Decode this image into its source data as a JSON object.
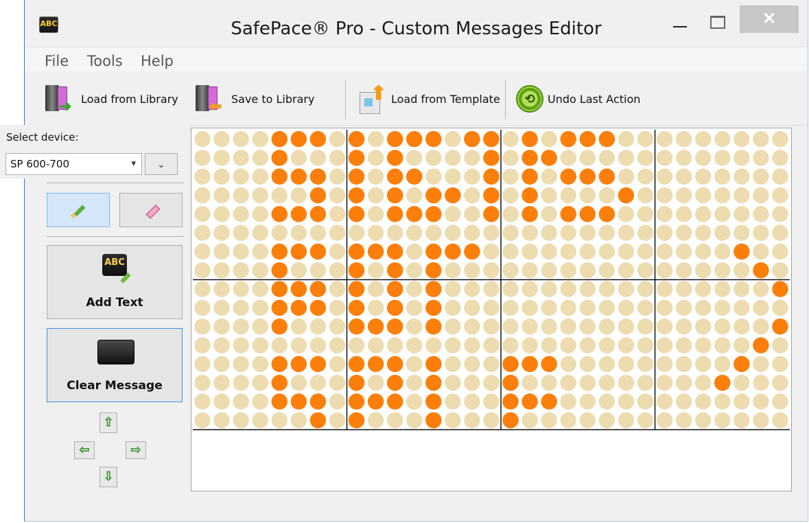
{
  "window": {
    "title": "SafePace® Pro - Custom Messages Editor",
    "app_icon_text": "ABC",
    "close_glyph": "✕"
  },
  "menu": {
    "items": [
      "File",
      "Tools",
      "Help"
    ]
  },
  "toolbar": {
    "load_library": "Load from Library",
    "save_library": "Save to Library",
    "load_template": "Load from Template",
    "undo": "Undo Last Action"
  },
  "device": {
    "label": "Select device:",
    "selected": "SP 600-700",
    "secondary_selected": ""
  },
  "side": {
    "add_text": "Add Text",
    "clear_message": "Clear Message",
    "arrows": {
      "up": "⇧",
      "left": "⇦",
      "right": "⇨",
      "down": "⇩"
    }
  },
  "led_display": {
    "columns": 31,
    "rows": 16,
    "on_color": "#fb7f0a",
    "off_color": "#ecdcb0",
    "pixels": [
      "0000111010111011010111000000000",
      "0000100010100001011000000000000",
      "0000111010110001010111000000000",
      "0000001010101101010000100000000",
      "0000111010111001010111000000000",
      "0000000000000000000000000000000",
      "0000111011101110000000000000100",
      "0000100010101000000000000000010",
      "0000111010101000000000000000001",
      "0000111010101000000000000000000",
      "0000100011101000000000000000001",
      "0000000000000000000000000000010",
      "0000111011101000111000000000100",
      "0000100010101000100000000001000",
      "0000111011101000111000000000000",
      "0000001010001000100000000000000"
    ]
  }
}
